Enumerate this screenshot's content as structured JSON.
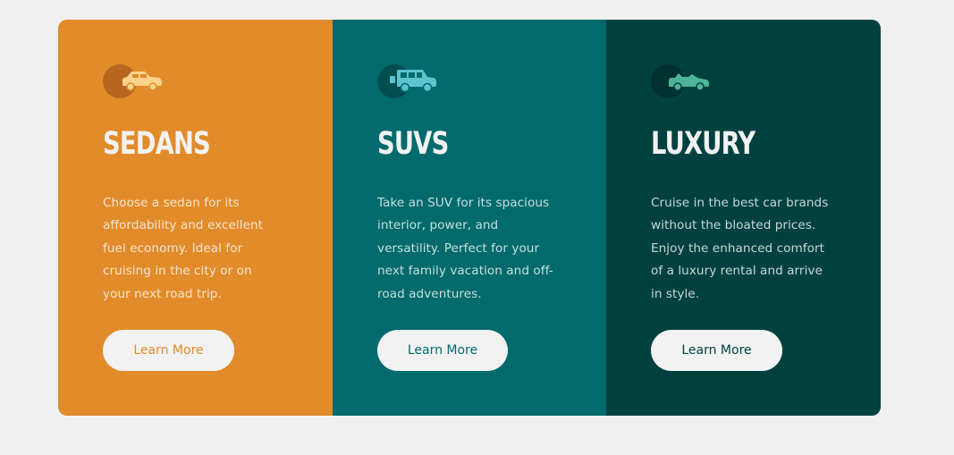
{
  "cards": [
    {
      "title": "SEDANS",
      "icon": "sedan-car-icon",
      "description": "Choose a sedan for its affordability and excellent fuel economy. Ideal for cruising in the city or on your next road trip.",
      "button_label": "Learn More",
      "color": "#e28b2a"
    },
    {
      "title": "SUVS",
      "icon": "suv-car-icon",
      "description": "Take an SUV for its spacious interior, power, and versatility. Perfect for your next family vacation and off-road adventures.",
      "button_label": "Learn More",
      "color": "#016a6c"
    },
    {
      "title": "LUXURY",
      "icon": "luxury-convertible-icon",
      "description": "Cruise in the best car brands without the bloated prices. Enjoy the enhanced comfort of a luxury rental and arrive in style.",
      "button_label": "Learn More",
      "color": "#004140"
    }
  ],
  "colors": {
    "page_background": "#f0f0f0",
    "button_background": "#f2f2f2",
    "heading": "#f2f2f2"
  }
}
